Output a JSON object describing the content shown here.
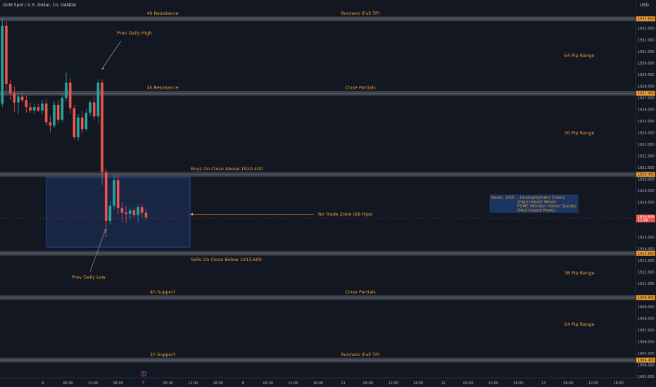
{
  "header": {
    "symbol": "Gold Spot / U.S. Dollar, 1h, OANDA",
    "currency": "USD"
  },
  "colors": {
    "background": "#131722",
    "bull": "#26a69a",
    "bear": "#ef5350",
    "annotation": "#f0a030",
    "level_line": "#787b86",
    "zone_fill": "#1e3a6e"
  },
  "chart_data": {
    "type": "candlestick",
    "ylim": [
      1903.0,
      1934.0
    ],
    "y_ticks": [
      "1934.000",
      "1933.000",
      "1932.000",
      "1931.000",
      "1930.000",
      "1929.000",
      "1928.000",
      "1927.000",
      "1926.000",
      "1925.000",
      "1924.000",
      "1923.000",
      "1922.000",
      "1921.000",
      "1920.000",
      "1919.000",
      "1918.000",
      "1917.000",
      "1916.000",
      "1915.000",
      "1914.000",
      "1913.000",
      "1912.000",
      "1911.000",
      "1910.000",
      "1909.000",
      "1908.000",
      "1907.000",
      "1906.000",
      "1905.000",
      "1904.000",
      "1903.000"
    ],
    "x_ticks": [
      "6",
      "06:00",
      "12:00",
      "18:00",
      "7",
      "06:00",
      "12:00",
      "18:00",
      "8",
      "06:00",
      "12:00",
      "18:00",
      "11",
      "06:00",
      "12:00",
      "18:00",
      "12",
      "06:00",
      "12:00",
      "18:00",
      "13",
      "06:00",
      "12:00",
      "18:00"
    ],
    "candles": [
      {
        "o": 1926.5,
        "h": 1933.8,
        "l": 1926.2,
        "c": 1933.2
      },
      {
        "o": 1933.2,
        "h": 1933.6,
        "l": 1927.5,
        "c": 1928.2
      },
      {
        "o": 1928.2,
        "h": 1928.6,
        "l": 1926.8,
        "c": 1927.4
      },
      {
        "o": 1927.4,
        "h": 1928.0,
        "l": 1925.8,
        "c": 1926.6
      },
      {
        "o": 1926.6,
        "h": 1927.4,
        "l": 1925.6,
        "c": 1927.1
      },
      {
        "o": 1927.1,
        "h": 1927.5,
        "l": 1926.6,
        "c": 1926.8
      },
      {
        "o": 1926.8,
        "h": 1927.2,
        "l": 1925.7,
        "c": 1926.2
      },
      {
        "o": 1926.2,
        "h": 1926.6,
        "l": 1925.7,
        "c": 1925.9
      },
      {
        "o": 1925.9,
        "h": 1926.5,
        "l": 1925.6,
        "c": 1926.2
      },
      {
        "o": 1926.2,
        "h": 1926.5,
        "l": 1925.8,
        "c": 1925.9
      },
      {
        "o": 1925.9,
        "h": 1926.8,
        "l": 1925.6,
        "c": 1926.5
      },
      {
        "o": 1926.5,
        "h": 1926.9,
        "l": 1924.6,
        "c": 1924.9
      },
      {
        "o": 1924.9,
        "h": 1925.4,
        "l": 1924.0,
        "c": 1924.6
      },
      {
        "o": 1924.6,
        "h": 1926.7,
        "l": 1924.4,
        "c": 1926.4
      },
      {
        "o": 1926.4,
        "h": 1926.8,
        "l": 1924.8,
        "c": 1925.1
      },
      {
        "o": 1925.1,
        "h": 1927.4,
        "l": 1924.9,
        "c": 1927.0
      },
      {
        "o": 1927.0,
        "h": 1929.2,
        "l": 1926.7,
        "c": 1928.3
      },
      {
        "o": 1928.3,
        "h": 1928.7,
        "l": 1925.6,
        "c": 1926.1
      },
      {
        "o": 1926.1,
        "h": 1926.4,
        "l": 1923.4,
        "c": 1923.6
      },
      {
        "o": 1923.6,
        "h": 1925.6,
        "l": 1923.3,
        "c": 1925.3
      },
      {
        "o": 1925.3,
        "h": 1925.9,
        "l": 1923.9,
        "c": 1924.3
      },
      {
        "o": 1924.3,
        "h": 1926.1,
        "l": 1924.1,
        "c": 1925.7
      },
      {
        "o": 1925.7,
        "h": 1926.8,
        "l": 1925.4,
        "c": 1926.6
      },
      {
        "o": 1926.6,
        "h": 1927.1,
        "l": 1925.1,
        "c": 1925.4
      },
      {
        "o": 1925.4,
        "h": 1928.6,
        "l": 1924.8,
        "c": 1928.3
      },
      {
        "o": 1928.3,
        "h": 1928.6,
        "l": 1919.5,
        "c": 1920.6
      },
      {
        "o": 1920.6,
        "h": 1920.9,
        "l": 1915.0,
        "c": 1916.4
      },
      {
        "o": 1916.4,
        "h": 1918.1,
        "l": 1916.1,
        "c": 1917.7
      },
      {
        "o": 1917.7,
        "h": 1920.4,
        "l": 1917.4,
        "c": 1919.9
      },
      {
        "o": 1919.9,
        "h": 1920.3,
        "l": 1917.0,
        "c": 1917.5
      },
      {
        "o": 1917.5,
        "h": 1918.0,
        "l": 1916.3,
        "c": 1917.1
      },
      {
        "o": 1917.1,
        "h": 1917.7,
        "l": 1916.2,
        "c": 1917.0
      },
      {
        "o": 1917.0,
        "h": 1917.5,
        "l": 1916.5,
        "c": 1917.3
      },
      {
        "o": 1917.3,
        "h": 1917.6,
        "l": 1916.7,
        "c": 1916.9
      },
      {
        "o": 1916.9,
        "h": 1917.8,
        "l": 1916.3,
        "c": 1917.6
      },
      {
        "o": 1917.6,
        "h": 1917.9,
        "l": 1916.7,
        "c": 1917.1
      },
      {
        "o": 1917.1,
        "h": 1917.4,
        "l": 1916.5,
        "c": 1916.7
      }
    ],
    "levels": [
      {
        "price": 1933.8,
        "tag": "1933.800",
        "label_left": "4h Resistance",
        "label_right": "Runners (Full TP)"
      },
      {
        "price": 1927.4,
        "tag": "1927.400",
        "label_left": "4h Resistance",
        "label_right": "Close Partials"
      },
      {
        "price": 1920.4,
        "tag": "1920.400",
        "label_left": "Buys On Close Above 1920.400",
        "label_right": ""
      },
      {
        "price": 1913.6,
        "tag": "1913.600",
        "label_left": "Sells On Close Below 1913.600",
        "label_right": ""
      },
      {
        "price": 1909.8,
        "tag": "1909.800",
        "label_left": "4h Support",
        "label_right": "Close Partials"
      },
      {
        "price": 1904.4,
        "tag": "1904.400",
        "label_left": "1h Support",
        "label_right": "Runners (Full TP)"
      }
    ],
    "zone": {
      "top": 1920.4,
      "bottom": 1914.2,
      "label": "No Trade Zone (68 Pips)"
    },
    "ranges": [
      "64 Pip Range",
      "70 Pip Range",
      "38 Pip Range",
      "54 Pip Range"
    ],
    "daily_high_label": "Prev Daily High",
    "daily_low_label": "Prev Daily Low",
    "current_price": "1916.635",
    "countdown": "12:48",
    "news": {
      "prefix": "News : USD",
      "lines": [
        "- Unemployment Claims",
        "(High Impact News)",
        "FOMC Member Harker Speaks",
        "(Med Impact News)"
      ]
    }
  }
}
